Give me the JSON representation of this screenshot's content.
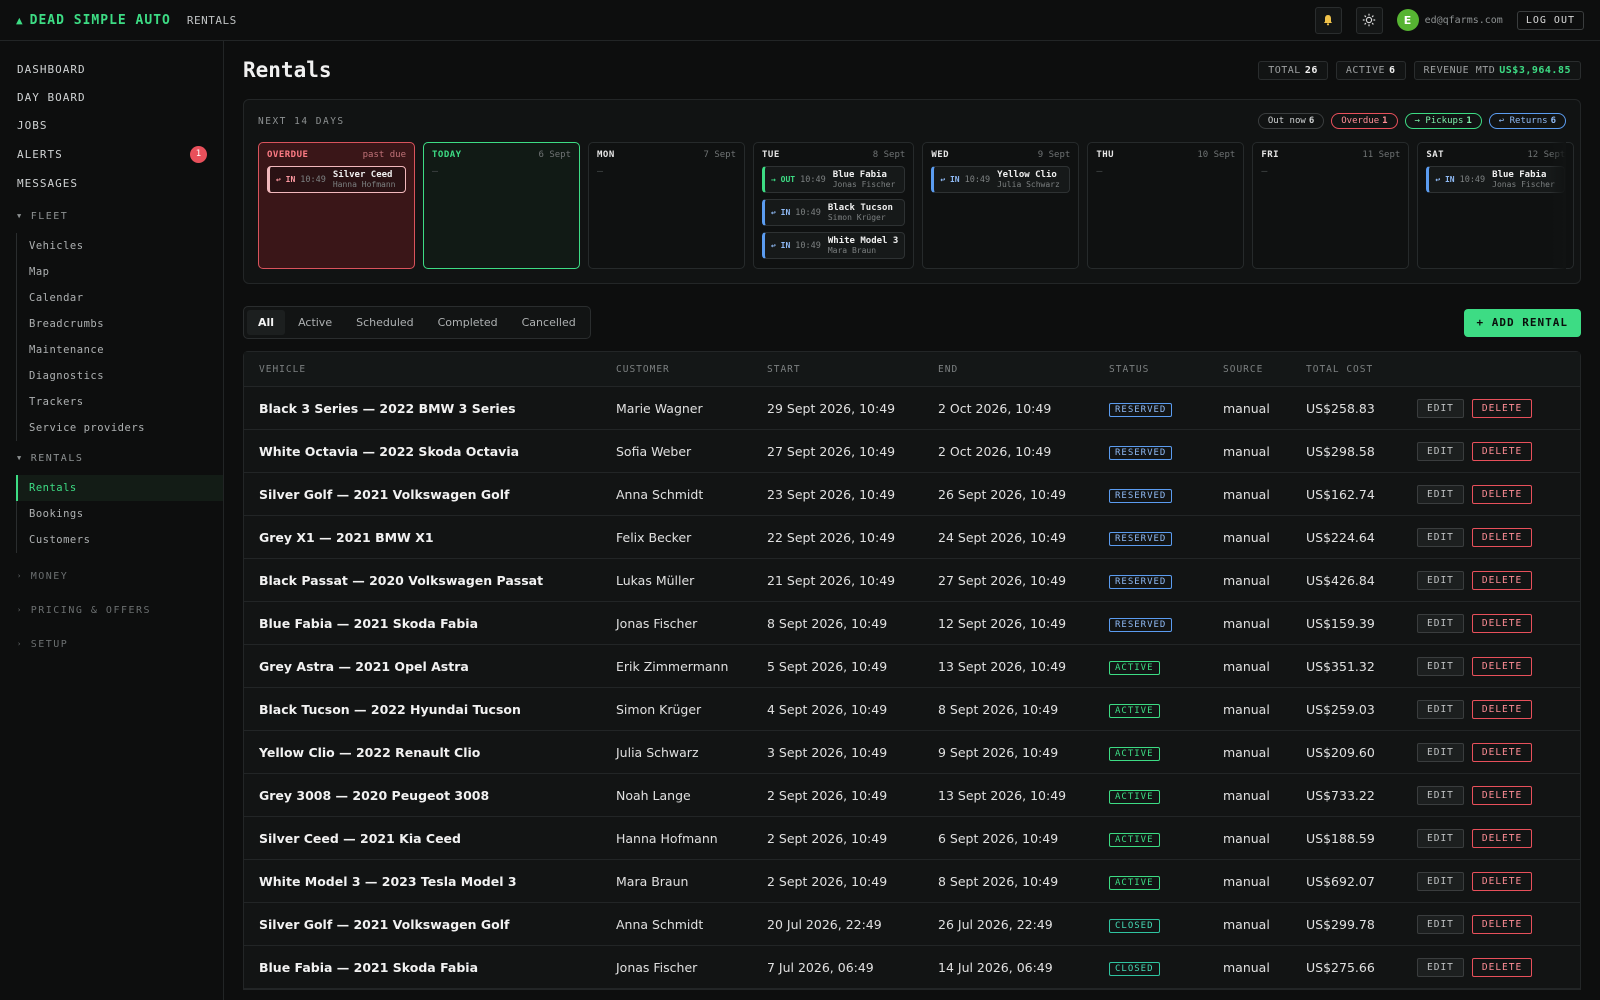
{
  "brand": {
    "logo_icon": "car-icon",
    "name": "DEAD SIMPLE AUTO"
  },
  "breadcrumb": "RENTALS",
  "user": {
    "initial": "E",
    "email": "ed@qfarms.com",
    "logout": "LOG OUT"
  },
  "nav": {
    "top": [
      "DASHBOARD",
      "DAY BOARD",
      "JOBS"
    ],
    "alerts": {
      "label": "ALERTS",
      "count": "1"
    },
    "messages": "MESSAGES",
    "fleet": {
      "label": "FLEET",
      "items": [
        "Vehicles",
        "Map",
        "Calendar",
        "Breadcrumbs",
        "Maintenance",
        "Diagnostics",
        "Trackers",
        "Service providers"
      ]
    },
    "rentals": {
      "label": "RENTALS",
      "items": [
        "Rentals",
        "Bookings",
        "Customers"
      ],
      "active": "Rentals"
    },
    "collapsed": [
      "MONEY",
      "PRICING & OFFERS",
      "SETUP"
    ]
  },
  "page": {
    "title": "Rentals"
  },
  "stats": [
    {
      "label": "TOTAL",
      "value": "26"
    },
    {
      "label": "ACTIVE",
      "value": "6"
    },
    {
      "label": "REVENUE MTD",
      "value": "US$3,964.85"
    }
  ],
  "schedule": {
    "label": "NEXT 14 DAYS",
    "chips": [
      {
        "label": "Out now",
        "count": "6"
      },
      {
        "label": "Overdue",
        "count": "1"
      },
      {
        "label": "→ Pickups",
        "count": "1"
      },
      {
        "label": "↩ Returns",
        "count": "6"
      }
    ],
    "days": [
      {
        "name": "OVERDUE",
        "date": "past due",
        "kind": "overdue",
        "events": [
          {
            "dir": "↩ IN",
            "time": "10:49",
            "car": "Silver Ceed",
            "customer": "Hanna Hofmann",
            "type": "od"
          }
        ]
      },
      {
        "name": "TODAY",
        "date": "6 Sept",
        "kind": "today",
        "events": []
      },
      {
        "name": "MON",
        "date": "7 Sept",
        "kind": "",
        "events": []
      },
      {
        "name": "TUE",
        "date": "8 Sept",
        "kind": "",
        "events": [
          {
            "dir": "→ OUT",
            "time": "10:49",
            "car": "Blue Fabia",
            "customer": "Jonas Fischer",
            "type": "out"
          },
          {
            "dir": "↩ IN",
            "time": "10:49",
            "car": "Black Tucson",
            "customer": "Simon Krüger",
            "type": "in"
          },
          {
            "dir": "↩ IN",
            "time": "10:49",
            "car": "White Model 3",
            "customer": "Mara Braun",
            "type": "in"
          }
        ]
      },
      {
        "name": "WED",
        "date": "9 Sept",
        "kind": "",
        "events": [
          {
            "dir": "↩ IN",
            "time": "10:49",
            "car": "Yellow Clio",
            "customer": "Julia Schwarz",
            "type": "in"
          }
        ]
      },
      {
        "name": "THU",
        "date": "10 Sept",
        "kind": "",
        "events": []
      },
      {
        "name": "FRI",
        "date": "11 Sept",
        "kind": "",
        "events": []
      },
      {
        "name": "SAT",
        "date": "12 Sept",
        "kind": "",
        "events": [
          {
            "dir": "↩ IN",
            "time": "10:49",
            "car": "Blue Fabia",
            "customer": "Jonas Fischer",
            "type": "in"
          }
        ]
      }
    ],
    "empty_mark": "—"
  },
  "filters": {
    "tabs": [
      "All",
      "Active",
      "Scheduled",
      "Completed",
      "Cancelled"
    ],
    "active": "All"
  },
  "add_button": "+ ADD RENTAL",
  "table": {
    "headers": [
      "VEHICLE",
      "CUSTOMER",
      "START",
      "END",
      "STATUS",
      "SOURCE",
      "TOTAL COST"
    ],
    "edit_label": "EDIT",
    "delete_label": "DELETE",
    "rows": [
      {
        "vehicle": "Black 3 Series — 2022 BMW 3 Series",
        "customer": "Marie Wagner",
        "start": "29 Sept 2026, 10:49",
        "end": "2 Oct 2026, 10:49",
        "status": "RESERVED",
        "source": "manual",
        "cost": "US$258.83"
      },
      {
        "vehicle": "White Octavia — 2022 Skoda Octavia",
        "customer": "Sofia Weber",
        "start": "27 Sept 2026, 10:49",
        "end": "2 Oct 2026, 10:49",
        "status": "RESERVED",
        "source": "manual",
        "cost": "US$298.58"
      },
      {
        "vehicle": "Silver Golf — 2021 Volkswagen Golf",
        "customer": "Anna Schmidt",
        "start": "23 Sept 2026, 10:49",
        "end": "26 Sept 2026, 10:49",
        "status": "RESERVED",
        "source": "manual",
        "cost": "US$162.74"
      },
      {
        "vehicle": "Grey X1 — 2021 BMW X1",
        "customer": "Felix Becker",
        "start": "22 Sept 2026, 10:49",
        "end": "24 Sept 2026, 10:49",
        "status": "RESERVED",
        "source": "manual",
        "cost": "US$224.64"
      },
      {
        "vehicle": "Black Passat — 2020 Volkswagen Passat",
        "customer": "Lukas Müller",
        "start": "21 Sept 2026, 10:49",
        "end": "27 Sept 2026, 10:49",
        "status": "RESERVED",
        "source": "manual",
        "cost": "US$426.84"
      },
      {
        "vehicle": "Blue Fabia — 2021 Skoda Fabia",
        "customer": "Jonas Fischer",
        "start": "8 Sept 2026, 10:49",
        "end": "12 Sept 2026, 10:49",
        "status": "RESERVED",
        "source": "manual",
        "cost": "US$159.39"
      },
      {
        "vehicle": "Grey Astra — 2021 Opel Astra",
        "customer": "Erik Zimmermann",
        "start": "5 Sept 2026, 10:49",
        "end": "13 Sept 2026, 10:49",
        "status": "ACTIVE",
        "source": "manual",
        "cost": "US$351.32"
      },
      {
        "vehicle": "Black Tucson — 2022 Hyundai Tucson",
        "customer": "Simon Krüger",
        "start": "4 Sept 2026, 10:49",
        "end": "8 Sept 2026, 10:49",
        "status": "ACTIVE",
        "source": "manual",
        "cost": "US$259.03"
      },
      {
        "vehicle": "Yellow Clio — 2022 Renault Clio",
        "customer": "Julia Schwarz",
        "start": "3 Sept 2026, 10:49",
        "end": "9 Sept 2026, 10:49",
        "status": "ACTIVE",
        "source": "manual",
        "cost": "US$209.60"
      },
      {
        "vehicle": "Grey 3008 — 2020 Peugeot 3008",
        "customer": "Noah Lange",
        "start": "2 Sept 2026, 10:49",
        "end": "13 Sept 2026, 10:49",
        "status": "ACTIVE",
        "source": "manual",
        "cost": "US$733.22"
      },
      {
        "vehicle": "Silver Ceed — 2021 Kia Ceed",
        "customer": "Hanna Hofmann",
        "start": "2 Sept 2026, 10:49",
        "end": "6 Sept 2026, 10:49",
        "status": "ACTIVE",
        "source": "manual",
        "cost": "US$188.59"
      },
      {
        "vehicle": "White Model 3 — 2023 Tesla Model 3",
        "customer": "Mara Braun",
        "start": "2 Sept 2026, 10:49",
        "end": "8 Sept 2026, 10:49",
        "status": "ACTIVE",
        "source": "manual",
        "cost": "US$692.07"
      },
      {
        "vehicle": "Silver Golf — 2021 Volkswagen Golf",
        "customer": "Anna Schmidt",
        "start": "20 Jul 2026, 22:49",
        "end": "26 Jul 2026, 22:49",
        "status": "CLOSED",
        "source": "manual",
        "cost": "US$299.78"
      },
      {
        "vehicle": "Blue Fabia — 2021 Skoda Fabia",
        "customer": "Jonas Fischer",
        "start": "7 Jul 2026, 06:49",
        "end": "14 Jul 2026, 06:49",
        "status": "CLOSED",
        "source": "manual",
        "cost": "US$275.66"
      }
    ]
  }
}
